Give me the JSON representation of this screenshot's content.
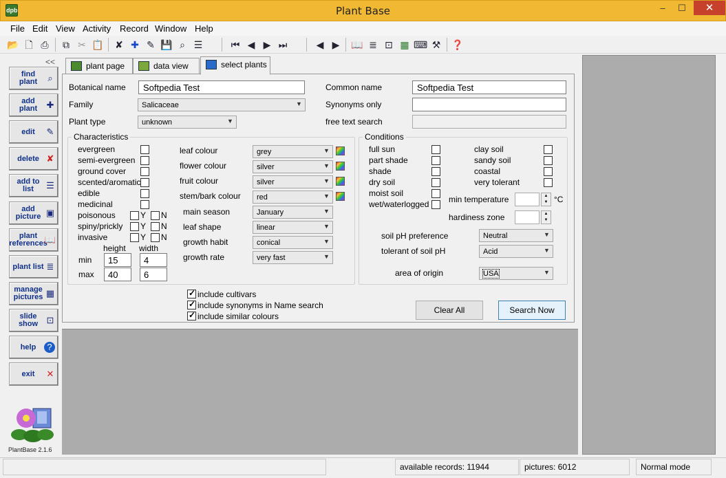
{
  "window": {
    "title": "Plant Base",
    "icon_text": "dpb",
    "min": "–",
    "max": "☐",
    "close": "✕"
  },
  "menu": [
    "File",
    "Edit",
    "View",
    "Activity",
    "Record",
    "Window",
    "Help"
  ],
  "toolbar": {
    "icons": [
      "open-folder-icon",
      "print-preview-icon",
      "print-icon",
      "copy-icon",
      "cut-icon",
      "paste-icon",
      "delete-record-icon",
      "new-record-icon",
      "edit-record-icon",
      "save-icon",
      "find-icon",
      "add-to-list-icon",
      "first-record-icon",
      "previous-record-icon",
      "next-record-icon",
      "last-record-icon",
      "back-icon",
      "forward-icon",
      "book-icon",
      "list-icon",
      "slideshow-icon",
      "pictures-icon",
      "keyboard-icon",
      "tools-icon",
      "help-icon"
    ]
  },
  "sidebar": {
    "collapse": "<<",
    "buttons": [
      {
        "label": "find plant",
        "icon": "binoculars-icon",
        "glyph": "⌕"
      },
      {
        "label": "add plant",
        "icon": "add-plant-icon",
        "glyph": "✚"
      },
      {
        "label": "edit",
        "icon": "edit-icon",
        "glyph": "✎"
      },
      {
        "label": "delete",
        "icon": "delete-icon",
        "glyph": "✘"
      },
      {
        "label": "add to list",
        "icon": "add-list-icon",
        "glyph": "☰"
      },
      {
        "label": "add picture",
        "icon": "add-picture-icon",
        "glyph": "▣"
      },
      {
        "label": "plant references",
        "icon": "book-icon",
        "glyph": "📖"
      },
      {
        "label": "plant list",
        "icon": "list-icon",
        "glyph": "≣"
      },
      {
        "label": "manage pictures",
        "icon": "pictures-icon",
        "glyph": "▦"
      },
      {
        "label": "slide show",
        "icon": "projector-icon",
        "glyph": "⊡"
      },
      {
        "label": "help",
        "icon": "help-icon",
        "glyph": "?"
      },
      {
        "label": "exit",
        "icon": "exit-icon",
        "glyph": "✕"
      }
    ],
    "version": "PlantBase 2.1.6"
  },
  "tabs": [
    "plant page",
    "data view",
    "select plants"
  ],
  "form": {
    "botanical_label": "Botanical name",
    "botanical_value": "Softpedia Test",
    "common_label": "Common name",
    "common_value": "Softpedia Test",
    "family_label": "Family",
    "family_value": "Salicaceae",
    "synonyms_label": "Synonyms only",
    "synonyms_value": "",
    "plant_type_label": "Plant type",
    "plant_type_value": "unknown",
    "free_text_label": "free text search",
    "free_text_value": ""
  },
  "characteristics": {
    "title": "Characteristics",
    "checks": [
      "evergreen",
      "semi-evergreen",
      "ground cover",
      "scented/aromatic",
      "edible",
      "medicinal"
    ],
    "yn": [
      "poisonous",
      "spiny/prickly",
      "invasive"
    ],
    "y": "Y",
    "n": "N",
    "height_label": "height",
    "width_label": "width",
    "min_label": "min",
    "max_label": "max",
    "min_height": "15",
    "min_width": "4",
    "max_height": "40",
    "max_width": "6",
    "colour_rows": [
      {
        "label": "leaf colour",
        "value": "grey"
      },
      {
        "label": "flower colour",
        "value": "silver"
      },
      {
        "label": "fruit colour",
        "value": "silver"
      },
      {
        "label": "stem/bark colour",
        "value": "red"
      }
    ],
    "other_rows": [
      {
        "label": "main season",
        "value": "January"
      },
      {
        "label": "leaf shape",
        "value": "linear"
      },
      {
        "label": "growth habit",
        "value": "conical"
      },
      {
        "label": "growth rate",
        "value": "very fast"
      }
    ]
  },
  "conditions": {
    "title": "Conditions",
    "left": [
      "full sun",
      "part shade",
      "shade",
      "dry soil",
      "moist soil",
      "wet/waterlogged"
    ],
    "right": [
      "clay soil",
      "sandy soil",
      "coastal",
      "very tolerant"
    ],
    "min_temp_label": "min temperature",
    "min_temp_unit": "°C",
    "hardiness_label": "hardiness zone",
    "ph_pref_label": "soil pH preference",
    "ph_pref_value": "Neutral",
    "ph_tol_label": "tolerant of soil pH",
    "ph_tol_value": "Acid",
    "origin_label": "area of origin",
    "origin_value": "USA"
  },
  "options": [
    "include cultivars",
    "include synonyms in Name search",
    "include similar colours"
  ],
  "buttons": {
    "clear": "Clear All",
    "search": "Search Now"
  },
  "status": {
    "records": "available records: 11944",
    "pictures": "pictures: 6012",
    "mode": "Normal mode"
  }
}
